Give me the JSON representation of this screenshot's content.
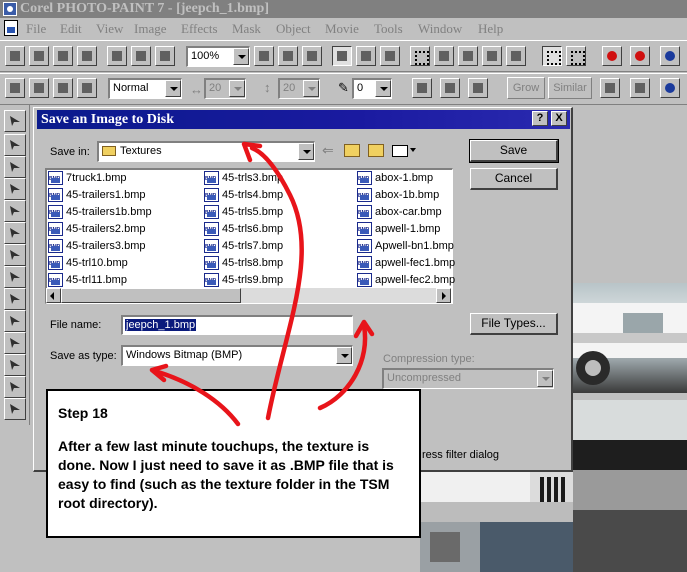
{
  "window": {
    "title": "Corel PHOTO-PAINT 7 - [jeepch_1.bmp]"
  },
  "menu": [
    "File",
    "Edit",
    "View",
    "Image",
    "Effects",
    "Mask",
    "Object",
    "Movie",
    "Tools",
    "Window",
    "Help"
  ],
  "toolbar": {
    "zoom": "100%",
    "merge_mode": "Normal",
    "width_value": "20",
    "height_value": "20",
    "tolerance_value": "0",
    "grow_label": "Grow",
    "similar_label": "Similar"
  },
  "dialog": {
    "title": "Save an Image to Disk",
    "help_label": "?",
    "close_label": "X",
    "save_in_label": "Save in:",
    "save_in_value": "Textures",
    "files": [
      [
        "7truck1.bmp",
        "45-trailers1.bmp",
        "45-trailers1b.bmp",
        "45-trailers2.bmp",
        "45-trailers3.bmp",
        "45-trl10.bmp",
        "45-trl11.bmp"
      ],
      [
        "45-trls3.bmp",
        "45-trls4.bmp",
        "45-trls5.bmp",
        "45-trls6.bmp",
        "45-trls7.bmp",
        "45-trls8.bmp",
        "45-trls9.bmp"
      ],
      [
        "abox-1.bmp",
        "abox-1b.bmp",
        "abox-car.bmp",
        "apwell-1.bmp",
        "Apwell-bn1.bmp",
        "apwell-fec1.bmp",
        "apwell-fec2.bmp"
      ]
    ],
    "file_name_label": "File name:",
    "file_name_value": "jeepch_1.bmp",
    "save_as_type_label": "Save as type:",
    "save_as_type_value": "Windows Bitmap (BMP)",
    "compression_label": "Compression type:",
    "compression_value": "Uncompressed",
    "save_button": "Save",
    "cancel_button": "Cancel",
    "file_types_button": "File Types...",
    "partial_option": "ress filter dialog"
  },
  "caption": {
    "step": "Step 18",
    "text": "After a few last minute touchups, the texture is done. Now I just need to save it as .BMP file that is easy to find (such as the texture folder in the TSM root directory)."
  },
  "colors": {
    "dialog_title_bg": "#0a1a8c",
    "annotation_arrows": "#e8141a",
    "selection": "#0a1a7c"
  }
}
